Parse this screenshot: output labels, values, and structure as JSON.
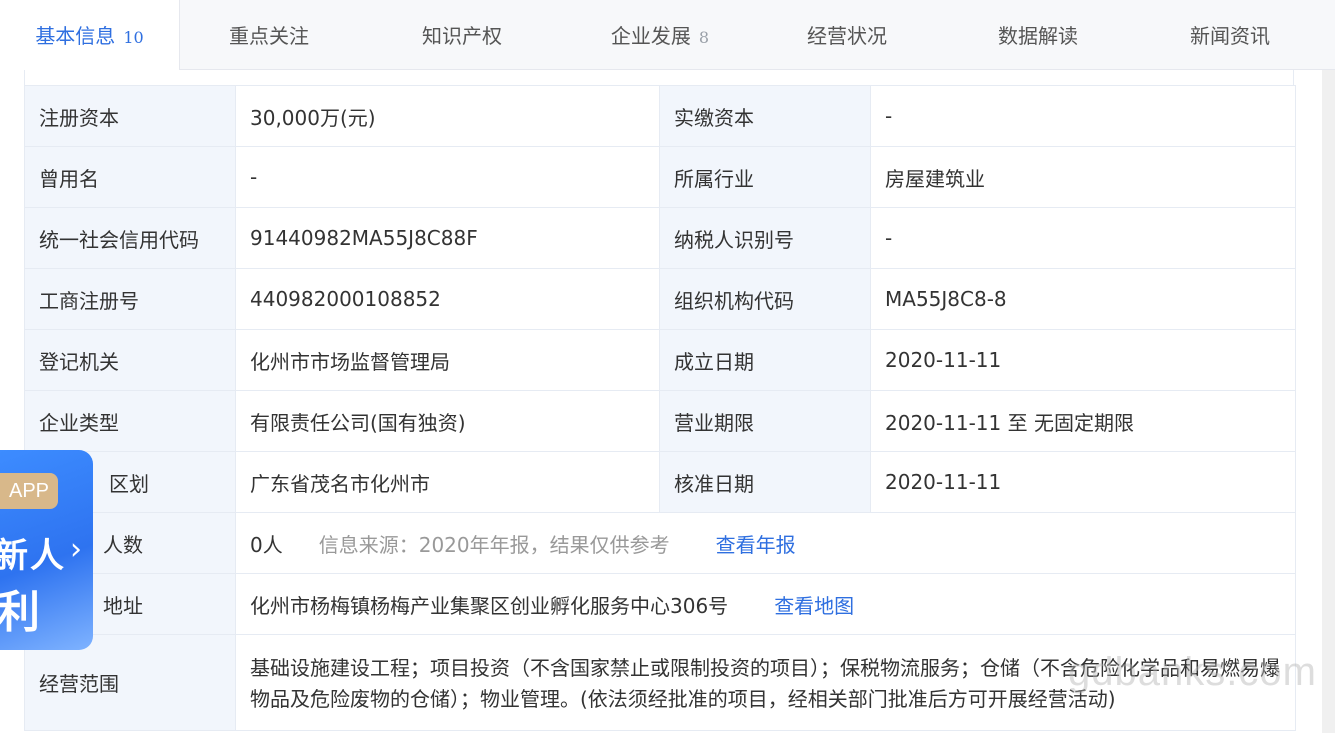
{
  "tabs": [
    {
      "label": "基本信息",
      "count": "10",
      "active": true
    },
    {
      "label": "重点关注",
      "count": ""
    },
    {
      "label": "知识产权",
      "count": ""
    },
    {
      "label": "企业发展",
      "count": "8"
    },
    {
      "label": "经营状况",
      "count": ""
    },
    {
      "label": "数据解读",
      "count": ""
    },
    {
      "label": "新闻资讯",
      "count": ""
    }
  ],
  "info": {
    "reg_capital_label": "注册资本",
    "reg_capital": "30,000万(元)",
    "paid_capital_label": "实缴资本",
    "paid_capital": "-",
    "former_name_label": "曾用名",
    "former_name": "-",
    "industry_label": "所属行业",
    "industry": "房屋建筑业",
    "credit_code_label": "统一社会信用代码",
    "credit_code": "91440982MA55J8C88F",
    "taxpayer_label": "纳税人识别号",
    "taxpayer": "-",
    "biz_reg_label": "工商注册号",
    "biz_reg": "440982000108852",
    "org_code_label": "组织机构代码",
    "org_code": "MA55J8C8-8",
    "authority_label": "登记机关",
    "authority": "化州市市场监督管理局",
    "founded_label": "成立日期",
    "founded": "2020-11-11",
    "type_label": "企业类型",
    "type": "有限责任公司(国有独资)",
    "term_label": "营业期限",
    "term": "2020-11-11 至 无固定期限",
    "region_label": "区划",
    "region": "广东省茂名市化州市",
    "approve_label": "核准日期",
    "approve": "2020-11-11",
    "staff_label": "人数",
    "staff": "0人",
    "staff_source": "信息来源：2020年年报，结果仅供参考",
    "staff_link": "查看年报",
    "address_label": "地址",
    "address": "化州市杨梅镇杨梅产业集聚区创业孵化服务中心306号",
    "address_link": "查看地图",
    "scope_label": "经营范围",
    "scope": "基础设施建设工程；项目投资（不含国家禁止或限制投资的项目）；保税物流服务；仓储（不含危险化学品和易燃易爆物品及危险废物的仓储）；物业管理。(依法须经批准的项目，经相关部门批准后方可开展经营活动)"
  },
  "promo": {
    "app": "APP",
    "line1": "新人",
    "line2": "利"
  },
  "watermark": "gdbanks.com"
}
